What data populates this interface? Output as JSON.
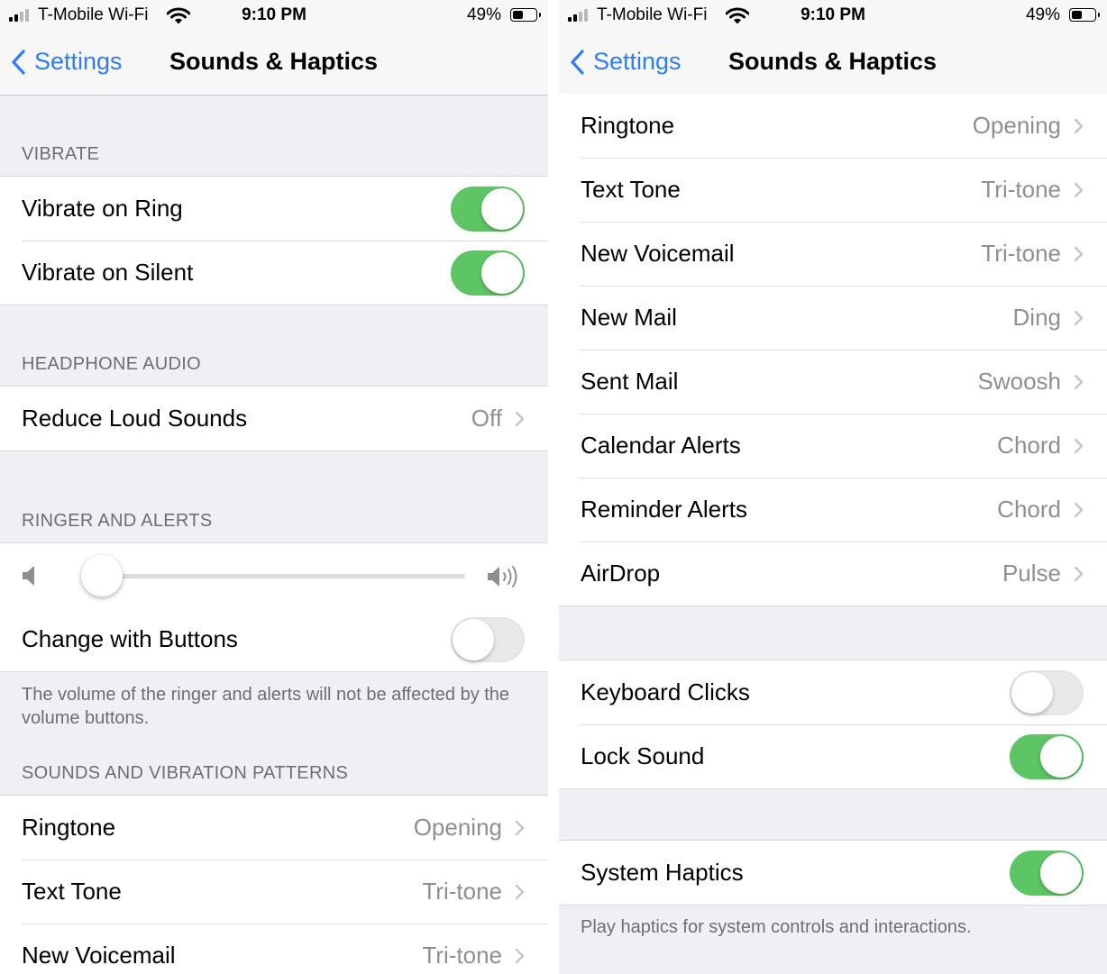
{
  "status": {
    "carrier": "T-Mobile Wi-Fi",
    "time": "9:10 PM",
    "battery": "49%"
  },
  "nav": {
    "back": "Settings",
    "title": "Sounds & Haptics"
  },
  "left": {
    "vibrate": {
      "header": "VIBRATE",
      "rows": [
        {
          "label": "Vibrate on Ring",
          "on": true
        },
        {
          "label": "Vibrate on Silent",
          "on": true
        }
      ]
    },
    "headphone": {
      "header": "HEADPHONE AUDIO",
      "rows": [
        {
          "label": "Reduce Loud Sounds",
          "value": "Off"
        }
      ]
    },
    "ringer": {
      "header": "RINGER AND ALERTS",
      "volume": 0.05,
      "change_label": "Change with Buttons",
      "change_on": false,
      "footer": "The volume of the ringer and alerts will not be affected by the volume buttons."
    },
    "patterns": {
      "header": "SOUNDS AND VIBRATION PATTERNS",
      "rows": [
        {
          "label": "Ringtone",
          "value": "Opening"
        },
        {
          "label": "Text Tone",
          "value": "Tri-tone"
        },
        {
          "label": "New Voicemail",
          "value": "Tri-tone"
        }
      ]
    }
  },
  "right": {
    "sounds": {
      "rows": [
        {
          "label": "Ringtone",
          "value": "Opening"
        },
        {
          "label": "Text Tone",
          "value": "Tri-tone"
        },
        {
          "label": "New Voicemail",
          "value": "Tri-tone"
        },
        {
          "label": "New Mail",
          "value": "Ding"
        },
        {
          "label": "Sent Mail",
          "value": "Swoosh"
        },
        {
          "label": "Calendar Alerts",
          "value": "Chord"
        },
        {
          "label": "Reminder Alerts",
          "value": "Chord"
        },
        {
          "label": "AirDrop",
          "value": "Pulse"
        }
      ]
    },
    "clicks": {
      "rows": [
        {
          "label": "Keyboard Clicks",
          "on": false
        },
        {
          "label": "Lock Sound",
          "on": true
        }
      ]
    },
    "haptics": {
      "rows": [
        {
          "label": "System Haptics",
          "on": true
        }
      ],
      "footer": "Play haptics for system controls and interactions."
    }
  },
  "colors": {
    "accent": "#2f7cf6",
    "toggle_on": "#5ec565",
    "background": "#efeff4"
  }
}
